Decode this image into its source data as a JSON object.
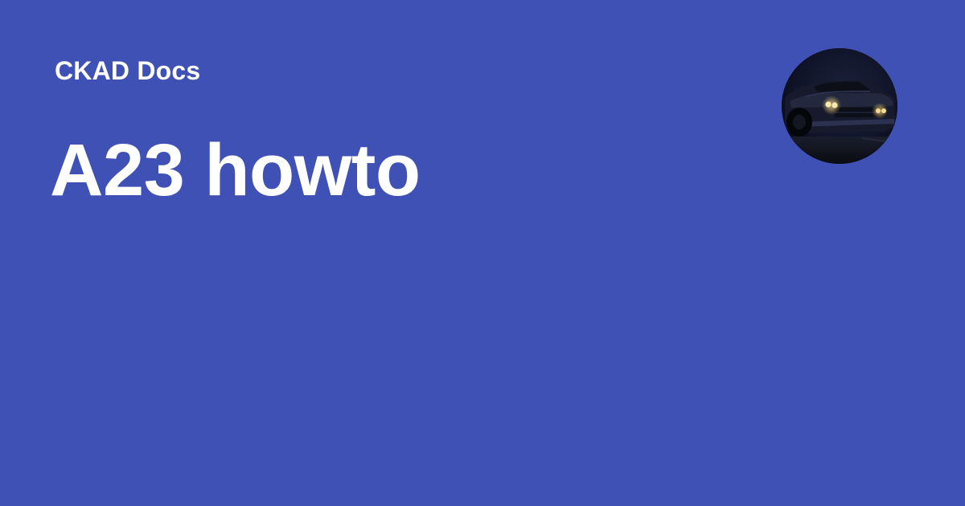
{
  "site": {
    "name": "CKAD Docs"
  },
  "page": {
    "title": "A23 howto"
  },
  "logo": {
    "icon": "car-at-night-avatar"
  },
  "colors": {
    "background": "#3f51b5",
    "text": "#ffffff"
  }
}
